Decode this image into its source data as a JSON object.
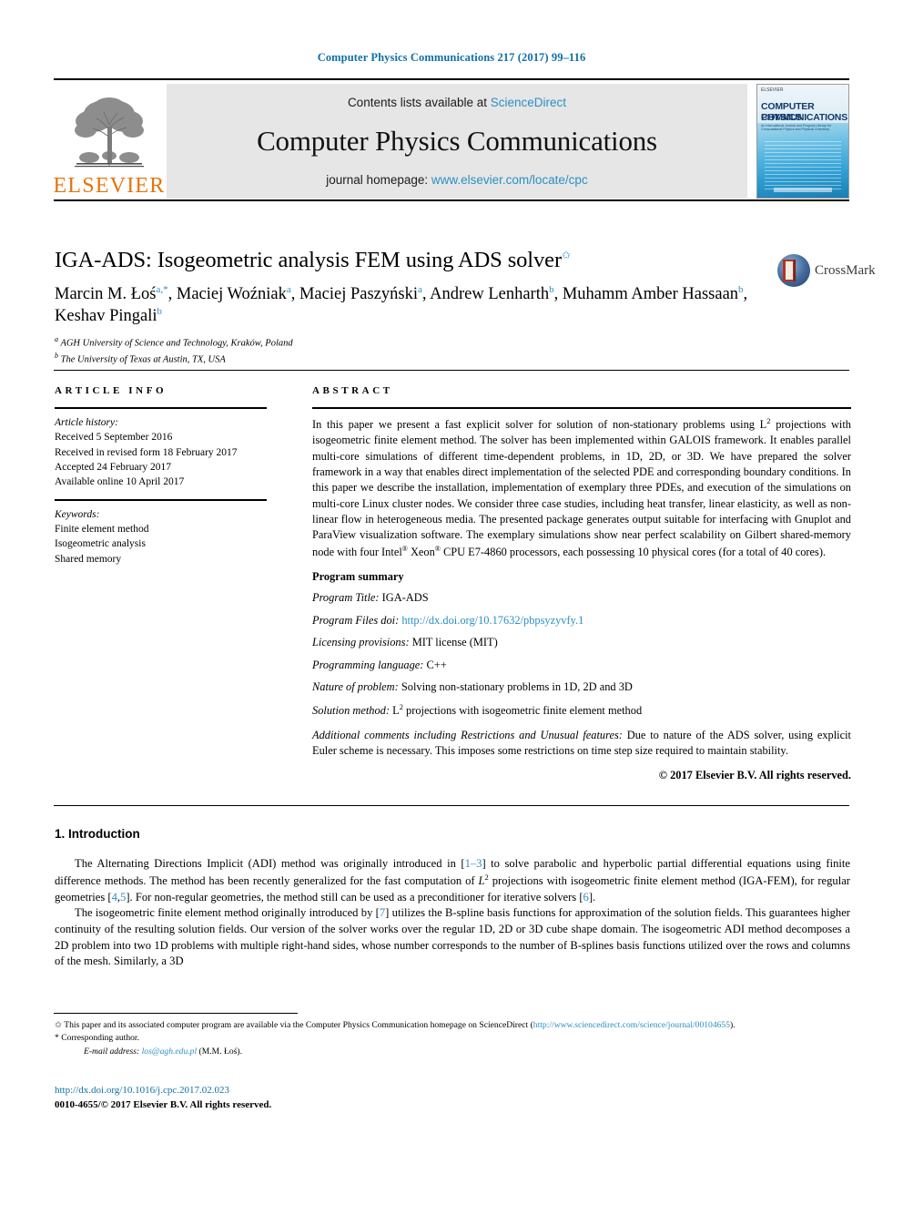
{
  "running_head": "Computer Physics Communications 217 (2017) 99–116",
  "masthead": {
    "contents_prefix": "Contents lists available at ",
    "contents_link": "ScienceDirect",
    "journal_title": "Computer Physics Communications",
    "homepage_prefix": "journal homepage: ",
    "homepage_link": "www.elsevier.com/locate/cpc",
    "publisher": "ELSEVIER",
    "cover": {
      "line1": "COMPUTER PHYSICS",
      "line2": "COMMUNICATIONS",
      "subtitle": "An International Journal and Program Library for Computational Physics and Physical Chemistry",
      "elsevier_mark": "ELSEVIER"
    }
  },
  "article": {
    "title": "IGA-ADS: Isogeometric analysis FEM using ADS solver",
    "title_star": "✩",
    "authors_html": "Marcin M. Łoś<sup class=\"aff\">a,*</sup>, Maciej Woźniak<sup class=\"aff\">a</sup>, Maciej Paszyński<sup class=\"aff\">a</sup>, Andrew Lenharth<sup class=\"aff\">b</sup>, Muhamm Amber Hassaan<sup class=\"aff\">b</sup>, Keshav Pingali<sup class=\"aff\">b</sup>",
    "affiliations": [
      {
        "mark": "a",
        "text": "AGH University of Science and Technology, Kraków, Poland"
      },
      {
        "mark": "b",
        "text": "The University of Texas at Austin, TX, USA"
      }
    ],
    "crossmark_label": "CrossMark"
  },
  "article_info": {
    "heading": "ARTICLE INFO",
    "history_label": "Article history:",
    "history": [
      "Received 5 September 2016",
      "Received in revised form 18 February 2017",
      "Accepted 24 February 2017",
      "Available online 10 April 2017"
    ],
    "keywords_label": "Keywords:",
    "keywords": [
      "Finite element method",
      "Isogeometric analysis",
      "Shared memory"
    ]
  },
  "abstract": {
    "heading": "ABSTRACT",
    "paragraph_html": "In this paper we present a fast explicit solver for solution of non-stationary problems using L<sup class=\"supnum\">2</sup> projections with isogeometric finite element method. The solver has been implemented within GALOIS framework. It enables parallel multi-core simulations of different time-dependent problems, in 1D, 2D, or 3D. We have prepared the solver framework in a way that enables direct implementation of the selected PDE and corresponding boundary conditions. In this paper we describe the installation, implementation of exemplary three PDEs, and execution of the simulations on multi-core Linux cluster nodes. We consider three case studies, including heat transfer, linear elasticity, as well as non-linear flow in heterogeneous media. The presented package generates output suitable for interfacing with Gnuplot and ParaView visualization software. The exemplary simulations show near perfect scalability on Gilbert shared-memory node with four Intel<sup class=\"sm\">®</sup> Xeon<sup class=\"sm\">®</sup> CPU E7-4860 processors, each possessing 10 physical cores (for a total of 40 cores).",
    "program_summary": {
      "title": "Program summary",
      "items": [
        {
          "label": "Program Title:",
          "value_html": " IGA-ADS"
        },
        {
          "label": "Program Files doi:",
          "value_html": " <a class=\"link\" href=\"#\">http://dx.doi.org/10.17632/pbpsyzyvfy.1</a>"
        },
        {
          "label": "Licensing provisions:",
          "value_html": " MIT license (MIT)"
        },
        {
          "label": "Programming language:",
          "value_html": " C++"
        },
        {
          "label": "Nature of problem:",
          "value_html": " Solving non-stationary problems in 1D, 2D and 3D"
        },
        {
          "label": "Solution method:",
          "value_html": " L<sup class=\"supnum\">2</sup> projections with isogeometric finite element method"
        }
      ],
      "additional_label": "Additional comments including Restrictions and Unusual features:",
      "additional_value": " Due to nature of the ADS solver, using explicit Euler scheme is necessary. This imposes some restrictions on time step size required to maintain stability."
    },
    "copyright": "© 2017 Elsevier B.V. All rights reserved."
  },
  "body": {
    "section_number_title": "1. Introduction",
    "paragraph1_html": "The Alternating Directions Implicit (ADI) method was originally introduced in [<a class=\"link\" href=\"#\">1–3</a>] to solve parabolic and hyperbolic partial differential equations using finite difference methods. The method has been recently generalized for the fast computation of <i>L</i><sup class=\"supnum\">2</sup> projections with isogeometric finite element method (IGA-FEM), for regular geometries [<a class=\"link\" href=\"#\">4</a>,<a class=\"link\" href=\"#\">5</a>]. For non-regular geometries, the method still can be used as a preconditioner for iterative solvers [<a class=\"link\" href=\"#\">6</a>].",
    "paragraph2_html": "The isogeometric finite element method originally introduced by [<a class=\"link\" href=\"#\">7</a>] utilizes the B-spline basis functions for approximation of the solution fields. This guarantees higher continuity of the resulting solution fields. Our version of the solver works over the regular 1D, 2D or 3D cube shape domain. The isogeometric ADI method decomposes a 2D problem into two 1D problems with multiple right-hand sides, whose number corresponds to the number of B-splines basis functions utilized over the rows and columns of the mesh. Similarly, a 3D"
  },
  "footnotes": {
    "star_note_html": "<span class=\"mark\">✩</span> This paper and its associated computer program are available via the Computer Physics Communication homepage on ScienceDirect (<a class=\"link\" href=\"#\">http://www.sciencedirect.com/science/journal/00104655</a>).",
    "corresponding_html": "<span class=\"mark\">*</span> Corresponding author.",
    "email_label": "E-mail address:",
    "email_link": "los@agh.edu.pl",
    "email_suffix": " (M.M. Łoś)."
  },
  "bottom": {
    "doi": "http://dx.doi.org/10.1016/j.cpc.2017.02.023",
    "issn_line": "0010-4655/© 2017 Elsevier B.V. All rights reserved."
  },
  "colors": {
    "link_blue": "#2b8fc4",
    "runhead_blue": "#0f6fa8",
    "elsevier_orange": "#e8730b",
    "masthead_gray": "#e6e6e6"
  }
}
